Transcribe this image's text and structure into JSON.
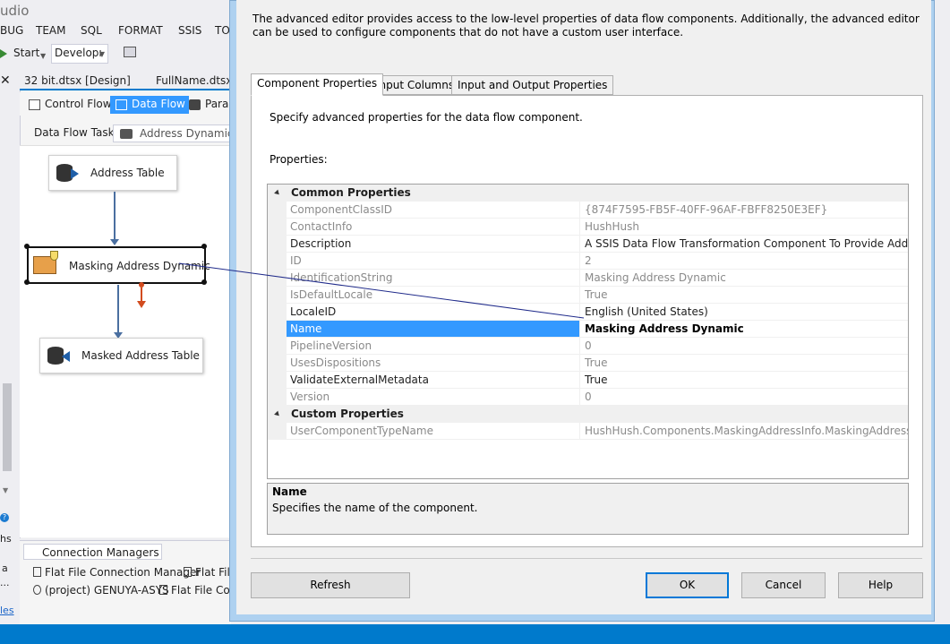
{
  "vs": {
    "title": "udio",
    "menu": [
      "BUG",
      "TEAM",
      "SQL",
      "FORMAT",
      "SSIS",
      "TO"
    ],
    "toolbar": {
      "start": "Start",
      "config": "Developı"
    },
    "doc_tabs": [
      "32 bit.dtsx [Design]",
      "FullName.dtsx ["
    ],
    "designer_tabs": [
      "Control Flow",
      "Data Flow",
      "Paran"
    ],
    "data_flow_task_label": "Data Flow Task:",
    "data_flow_task_value": "Address Dynamic",
    "nodes": {
      "source": "Address Table",
      "transform": "Masking Address Dynamic",
      "destination": "Masked Address Table"
    },
    "connection_managers": {
      "tab": "Connection Managers",
      "items": [
        "Flat File Connection Manager",
        "Flat File",
        "(project) GENUYA-ASYS",
        "Flat File Conn"
      ]
    },
    "side_fragments": {
      "a": "hs",
      "b": "a",
      "c": "...",
      "link": "les"
    }
  },
  "dialog": {
    "description": "The advanced editor provides access to the low-level properties of data flow components. Additionally, the advanced editor can be used to configure components that do not have a custom user interface.",
    "tabs": [
      "Component Properties",
      "Input Columns",
      "Input and Output Properties"
    ],
    "tab_description": "Specify advanced properties for the data flow component.",
    "properties_label": "Properties:",
    "categories": {
      "common": "Common Properties",
      "custom": "Custom Properties"
    },
    "properties": [
      {
        "name": "ComponentClassID",
        "value": "{874F7595-FB5F-40FF-96AF-FBFF8250E3EF}"
      },
      {
        "name": "ContactInfo",
        "value": "HushHush"
      },
      {
        "name": "Description",
        "value": "A SSIS Data Flow Transformation Component To Provide Address Masking"
      },
      {
        "name": "ID",
        "value": "2"
      },
      {
        "name": "IdentificationString",
        "value": "Masking Address Dynamic"
      },
      {
        "name": "IsDefaultLocale",
        "value": "True"
      },
      {
        "name": "LocaleID",
        "value": "English (United States)"
      },
      {
        "name": "Name",
        "value": "Masking Address Dynamic"
      },
      {
        "name": "PipelineVersion",
        "value": "0"
      },
      {
        "name": "UsesDispositions",
        "value": "True"
      },
      {
        "name": "ValidateExternalMetadata",
        "value": "True"
      },
      {
        "name": "Version",
        "value": "0"
      }
    ],
    "custom_properties": [
      {
        "name": "UserComponentTypeName",
        "value": "HushHush.Components.MaskingAddressInfo.MaskingAddressInfoComponent"
      }
    ],
    "help": {
      "title": "Name",
      "text": "Specifies the name of the component."
    },
    "buttons": {
      "refresh": "Refresh",
      "ok": "OK",
      "cancel": "Cancel",
      "help": "Help"
    }
  },
  "colors": {
    "accent": "#007acc",
    "selection": "#3399ff",
    "dialog_frame": "#aed1f0",
    "error_output": "#d24c1f",
    "flow_path": "#4a6fa0"
  }
}
